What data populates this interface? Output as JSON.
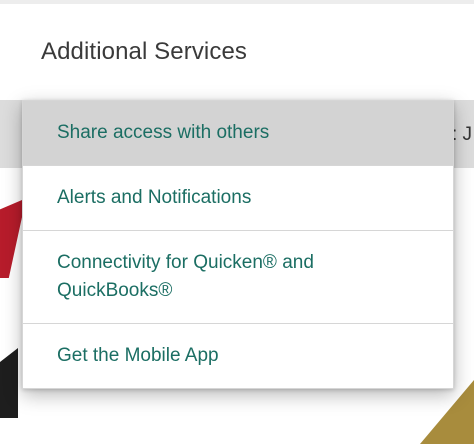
{
  "section": {
    "title": "Additional Services"
  },
  "background": {
    "partial_text": ": J"
  },
  "menu": {
    "items": [
      {
        "label": "Share access with others",
        "highlighted": true
      },
      {
        "label": "Alerts and Notifications",
        "highlighted": false
      },
      {
        "label": "Connectivity for Quicken® and QuickBooks®",
        "highlighted": false
      },
      {
        "label": "Get the Mobile App",
        "highlighted": false
      }
    ]
  },
  "colors": {
    "item_text": "#1b6e63",
    "highlight_bg": "#d3d3d3",
    "title_text": "#3a3a3a"
  }
}
